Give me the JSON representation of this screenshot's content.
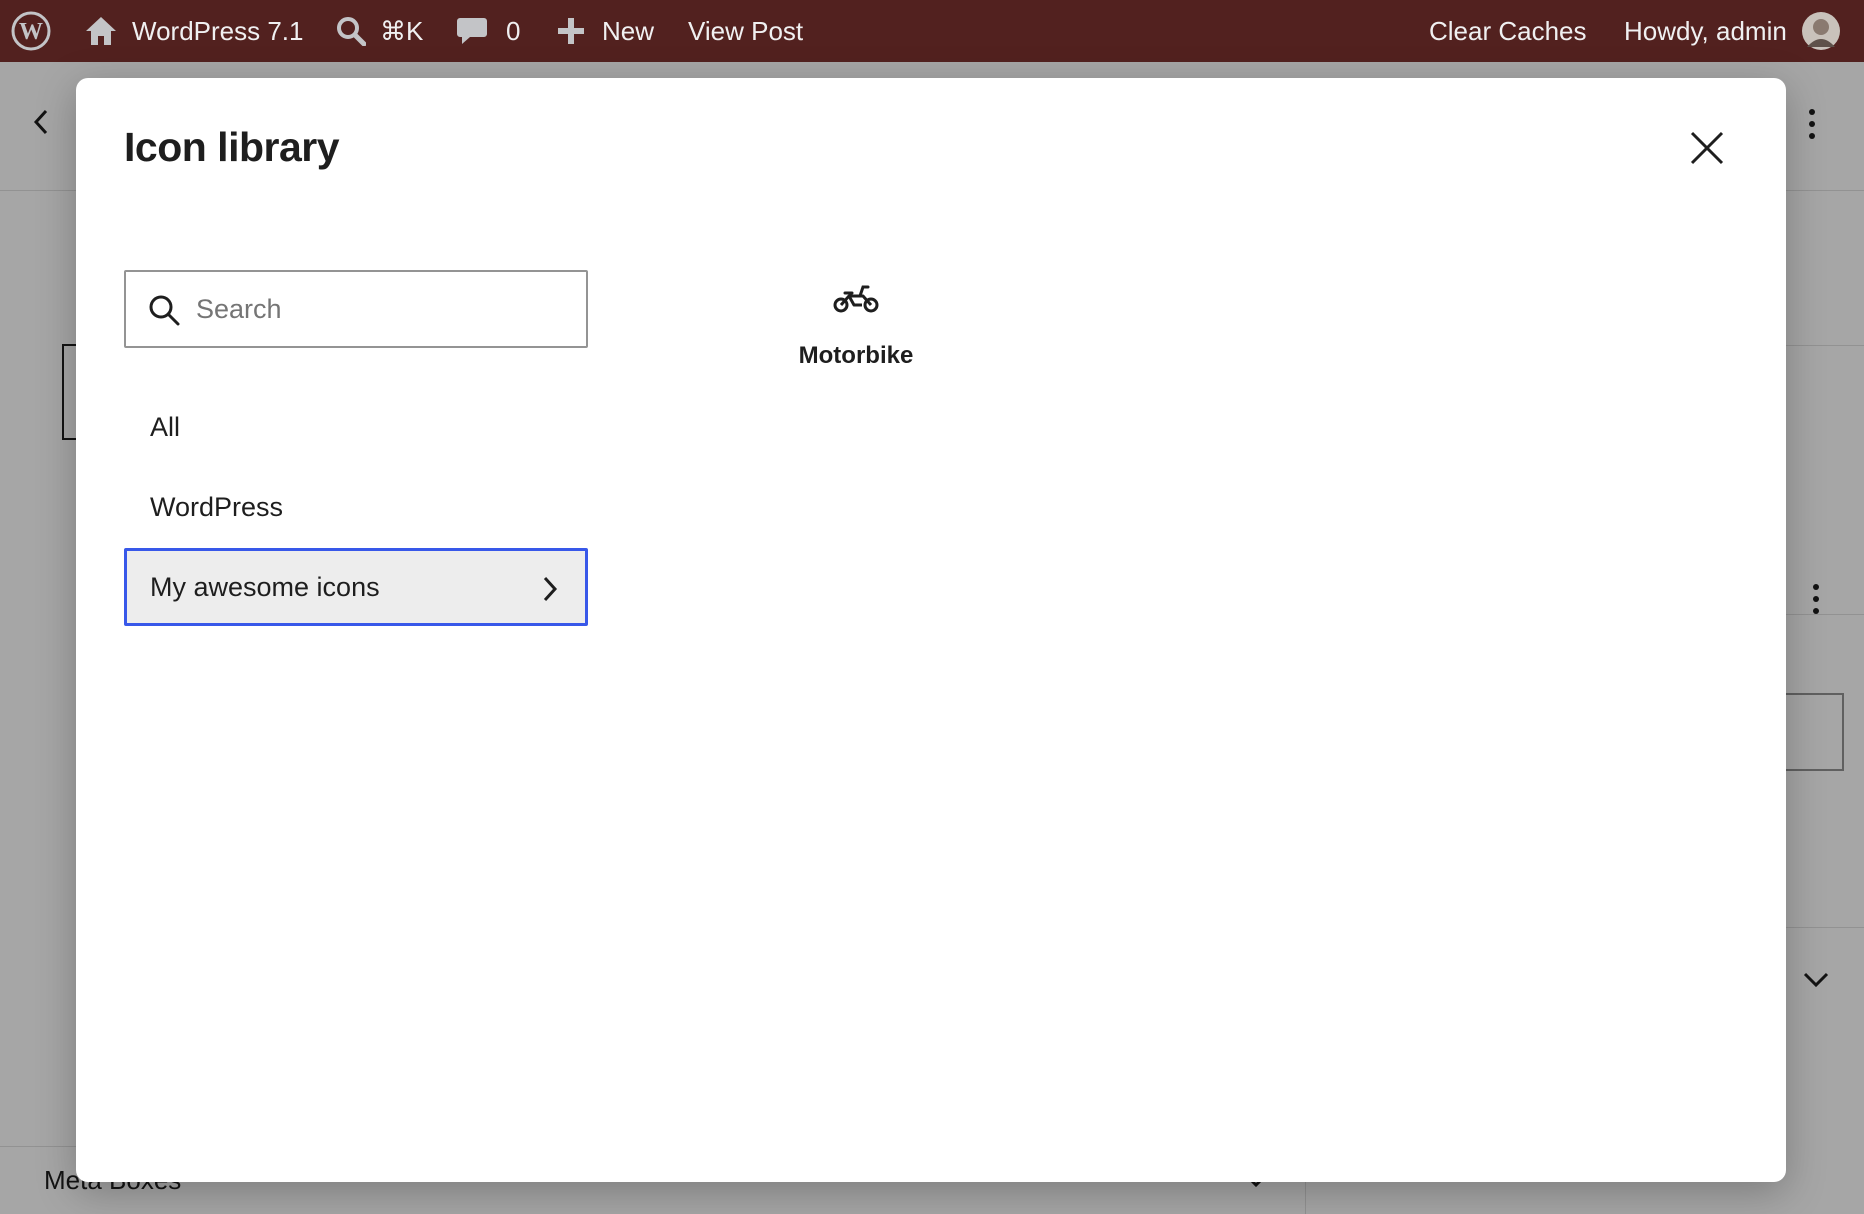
{
  "admin_bar": {
    "site_name": "WordPress 7.1",
    "command_shortcut": "⌘K",
    "comments_count": "0",
    "new_label": "New",
    "view_post_label": "View Post",
    "clear_caches_label": "Clear Caches",
    "howdy_label": "Howdy, admin",
    "background_color": "#52211f"
  },
  "editor": {
    "meta_boxes_label": "Meta Boxes"
  },
  "modal": {
    "title": "Icon library",
    "search_placeholder": "Search",
    "categories": [
      {
        "label": "All",
        "selected": false
      },
      {
        "label": "WordPress",
        "selected": false
      },
      {
        "label": "My awesome icons",
        "selected": true
      }
    ],
    "icons": [
      {
        "name": "Motorbike",
        "icon": "motorbike-icon"
      }
    ],
    "accent_color": "#3858e9"
  }
}
